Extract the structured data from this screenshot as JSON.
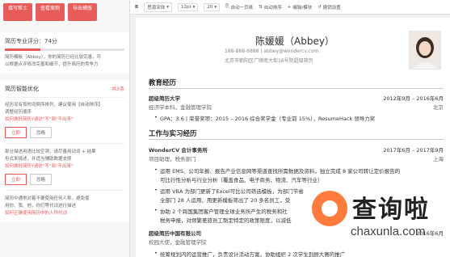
{
  "left": {
    "buttons": [
      "填写帮士",
      "查看案例",
      "导出模版"
    ],
    "score": {
      "label": "简历专业评分：74分",
      "value": 74
    },
    "score_desc": [
      "简历模板（Abbey），你的简历已经比较完善，可",
      "以根据点评修改完善和细节，提升简历的竞争力"
    ],
    "suggest_title": "简历智能优化",
    "suggest_count": "共3条",
    "items": [
      {
        "lines": [
          "经历没有按时间倒序排列，建议使用【自动排序】",
          "调整经历顺序"
        ],
        "link": "如何做好简历?请访\"写\"简\"不出来\"",
        "ignore": "忽略",
        "fix": "立即"
      },
      {
        "lines": [
          "部分描述用语比较空洞，请尽量用动词 + 结果",
          "形式来描述，并适当辅助数据支撑"
        ],
        "link": "如何做好简历?请访\"写\"简\"不出来\"",
        "ignore": "忽略",
        "fix": "立即"
      },
      {
        "lines": [
          "简历中通常对着不要使用任何人称，避免使",
          "用你、我、他，你们等代词进行描述"
        ],
        "link": "如何正确使用简历中的人称代词",
        "ignore": "",
        "fix": ""
      }
    ]
  },
  "toolbar": {
    "items": [
      "B",
      "思源宋体",
      "12pt",
      "20",
      "自动一页纸",
      "自动排序",
      "编辑/模块",
      "撤销设置"
    ]
  },
  "resume": {
    "name": "陈媛媛（Abbey）",
    "contact": "188-888-6888 | abbey@wondercv.com",
    "address": "北京市朝阳区广顺南大街16号院超级简历",
    "edu_title": "教育经历",
    "edu": {
      "school": "超级简历大学",
      "date": "2012年9月 – 2016年6月",
      "major": "经济学本科，金融管理学院",
      "city": "北京",
      "gpa": "GPA：3.6 | 荣誉奖项：2015 – 2016 综合奖学金（专业前 15%），ResumeHack 领导力奖"
    },
    "work_title": "工作与实习经历",
    "work1": {
      "company": "WonderCV 会计事务所",
      "date": "2017年6月 – 2017年9月",
      "role": "项目助理，税务部门",
      "city": "上海",
      "b1a": "运用 EMS、公司年报、报告产业信息网等渠道查找所需数据及资料，独立完成 8 家公司转让定价报告的",
      "b1b": "可比行性分析与行业分析（覆盖食品、电子商务、物流、汽车等行业）",
      "b2a": "运用 VBA 为部门更新了Excel可比公司筛选模板，为部门节省",
      "b2b": "全部门 28 人运用，用更新模板筛出了 20 多名员工，受",
      "b3a": "协助 2 个跨国集团客户管理全球业务所产生的税务和社",
      "b3b": "税务申报，对频繁差旅员工制定特定的政策限度，以减低"
    },
    "work2": {
      "company": "超级简历中国有限公司",
      "date": "2016年6月",
      "role": "校园大使，金融管理学院",
      "b1": "统筹规划内的运营推广，负责设计活动方案，协助组织 2 次学生到顾大赛的推广"
    }
  },
  "watermark": {
    "text": "查询啦",
    "url": "chaxunla.com"
  },
  "colors": {
    "accent": "#e85b5b",
    "watermark": "#ff7a3d"
  }
}
